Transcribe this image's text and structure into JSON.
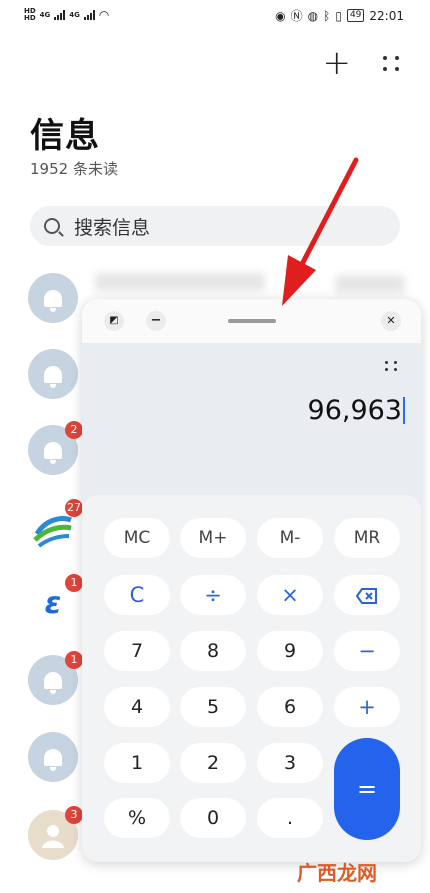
{
  "status_bar": {
    "sig1": "HD",
    "sig2": "HD",
    "net": "4G",
    "net2": "4G",
    "battery": "49",
    "time": "22:01"
  },
  "header": {
    "title": "信息",
    "unread": "1952 条未读"
  },
  "search": {
    "placeholder": "搜索信息"
  },
  "conversations": [
    {
      "avatar": "bell-icon",
      "badge": ""
    },
    {
      "avatar": "bell-icon",
      "badge": ""
    },
    {
      "avatar": "bell-icon",
      "badge": "2"
    },
    {
      "avatar": "china-mobile-logo",
      "badge": "27"
    },
    {
      "avatar": "china-telecom-logo",
      "badge": "1"
    },
    {
      "avatar": "bell-icon",
      "badge": "1"
    },
    {
      "avatar": "bell-icon",
      "badge": ""
    },
    {
      "avatar": "person-icon",
      "badge": "3"
    }
  ],
  "calculator": {
    "minus_label": "−",
    "close_label": "✕",
    "display": "96,963",
    "keys": {
      "mc": "MC",
      "mplus": "M+",
      "mminus": "M-",
      "mr": "MR",
      "c": "C",
      "div": "÷",
      "mul": "×",
      "k7": "7",
      "k8": "8",
      "k9": "9",
      "minus": "−",
      "k4": "4",
      "k5": "5",
      "k6": "6",
      "plus": "+",
      "k1": "1",
      "k2": "2",
      "k3": "3",
      "eq": "=",
      "pct": "%",
      "k0": "0",
      "dot": "."
    }
  },
  "watermark": "广西龙网",
  "colors": {
    "accent": "#2463ec",
    "badge": "#e0453a",
    "arrow": "#e01e1e"
  }
}
